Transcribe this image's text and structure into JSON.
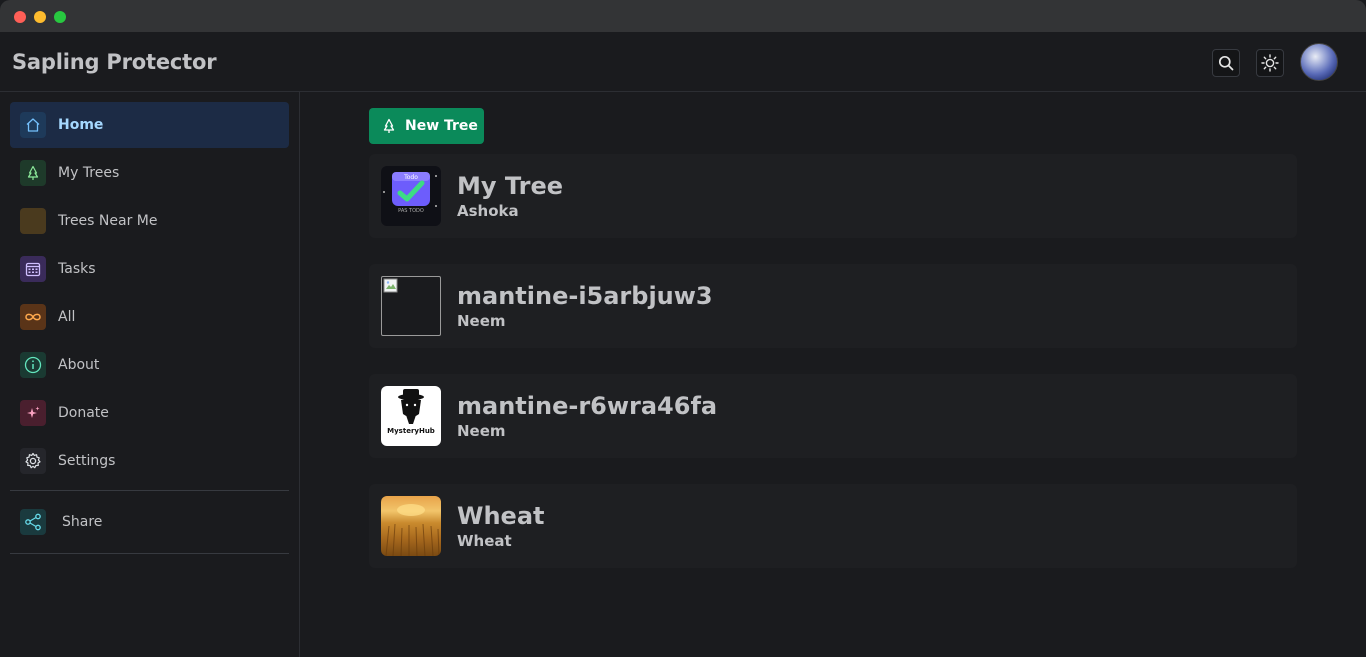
{
  "app": {
    "title": "Sapling Protector"
  },
  "header": {
    "search_icon": "search-icon",
    "theme_icon": "sun-icon"
  },
  "sidebar": {
    "items": [
      {
        "label": "Home",
        "icon": "home-icon",
        "active": true,
        "color": "#1c2b45"
      },
      {
        "label": "My Trees",
        "icon": "tree-icon",
        "color": "#1e3a2a"
      },
      {
        "label": "Trees Near Me",
        "icon": "map-icon",
        "color": "#4a3a1e"
      },
      {
        "label": "Tasks",
        "icon": "calendar-icon",
        "color": "#3a2b5a"
      },
      {
        "label": "All",
        "icon": "infinity-icon",
        "color": "#5a3418"
      },
      {
        "label": "About",
        "icon": "info-icon",
        "color": "#1a3a32"
      },
      {
        "label": "Donate",
        "icon": "sparkles-icon",
        "color": "#4a1f2e"
      },
      {
        "label": "Settings",
        "icon": "gear-icon",
        "color": "#25262b"
      }
    ],
    "share": {
      "label": "Share",
      "icon": "share-icon",
      "color": "#1a3a3e"
    }
  },
  "main": {
    "new_tree_label": "New Tree",
    "trees": [
      {
        "name": "My Tree",
        "species": "Ashoka",
        "thumb": "todo-app-image",
        "thumb_text_top": "Todo",
        "thumb_text_bottom": "PAS TODO"
      },
      {
        "name": "mantine-i5arbjuw3",
        "species": "Neem",
        "thumb": "broken-image"
      },
      {
        "name": "mantine-r6wra46fa",
        "species": "Neem",
        "thumb": "mysteryhub-logo",
        "thumb_text": "MysteryHub"
      },
      {
        "name": "Wheat",
        "species": "Wheat",
        "thumb": "wheat-field-image"
      }
    ]
  },
  "colors": {
    "accent": "#0b8a5a",
    "active_nav_text": "#a5d8ff",
    "background": "#1a1b1e"
  }
}
